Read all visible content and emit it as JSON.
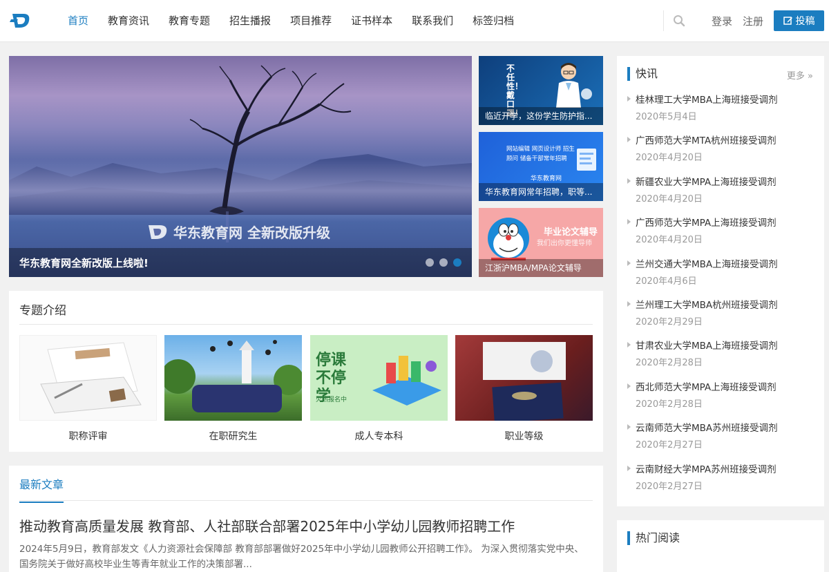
{
  "nav": {
    "items": [
      {
        "label": "首页",
        "active": true
      },
      {
        "label": "教育资讯"
      },
      {
        "label": "教育专题"
      },
      {
        "label": "招生播报"
      },
      {
        "label": "项目推荐"
      },
      {
        "label": "证书样本"
      },
      {
        "label": "联系我们"
      },
      {
        "label": "标签归档"
      }
    ],
    "login": "登录",
    "register": "注册",
    "submit": "投稿"
  },
  "slider": {
    "watermark": "华东教育网 全新改版升级",
    "caption": "华东教育网全新改版上线啦!",
    "dot_count": 3,
    "active_dot": 3
  },
  "tiles": [
    {
      "caption": "临近开学，这份学生防护指...",
      "art_text": "不任性！戴口罩！"
    },
    {
      "caption": "华东教育网常年招聘，职等...",
      "art_text": "网站编辑  网页设计师  招生顾问  储备干部常年招聘",
      "brand": "华东教育网"
    },
    {
      "caption": "江浙沪MBA/MPA论文辅导",
      "art_text": "毕业论文辅导",
      "art_sub": "我们出你更懂导师"
    }
  ],
  "topics": {
    "title": "专题介绍",
    "items": [
      {
        "label": "职称评审"
      },
      {
        "label": "在职研究生"
      },
      {
        "label": "成人专本科",
        "art_text": "停课不停学",
        "art_sub": "火热报名中"
      },
      {
        "label": "职业等级"
      }
    ]
  },
  "latest": {
    "tab": "最新文章",
    "article_title": "推动教育高质量发展 教育部、人社部联合部署2025年中小学幼儿园教师招聘工作",
    "article_excerpt": "2024年5月9日，教育部发文《人力资源社会保障部 教育部部署做好2025年中小学幼儿园教师公开招聘工作》。 为深入贯彻落实党中央、国务院关于做好高校毕业生等青年就业工作的决策部署..."
  },
  "news": {
    "title": "快讯",
    "more": "更多 »",
    "items": [
      {
        "title": "桂林理工大学MBA上海班接受调剂",
        "date": "2020年5月4日"
      },
      {
        "title": "广西师范大学MTA杭州班接受调剂",
        "date": "2020年4月20日"
      },
      {
        "title": "新疆农业大学MPA上海班接受调剂",
        "date": "2020年4月20日"
      },
      {
        "title": "广西师范大学MPA上海班接受调剂",
        "date": "2020年4月20日"
      },
      {
        "title": "兰州交通大学MBA上海班接受调剂",
        "date": "2020年4月6日"
      },
      {
        "title": "兰州理工大学MBA杭州班接受调剂",
        "date": "2020年2月29日"
      },
      {
        "title": "甘肃农业大学MBA上海班接受调剂",
        "date": "2020年2月28日"
      },
      {
        "title": "西北师范大学MPA上海班接受调剂",
        "date": "2020年2月28日"
      },
      {
        "title": "云南师范大学MBA苏州班接受调剂",
        "date": "2020年2月27日"
      },
      {
        "title": "云南财经大学MPA苏州班接受调剂",
        "date": "2020年2月27日"
      }
    ]
  },
  "hot": {
    "title": "热门阅读"
  },
  "colors": {
    "accent": "#1b7dc0",
    "page_bg": "#f1f1f1"
  }
}
